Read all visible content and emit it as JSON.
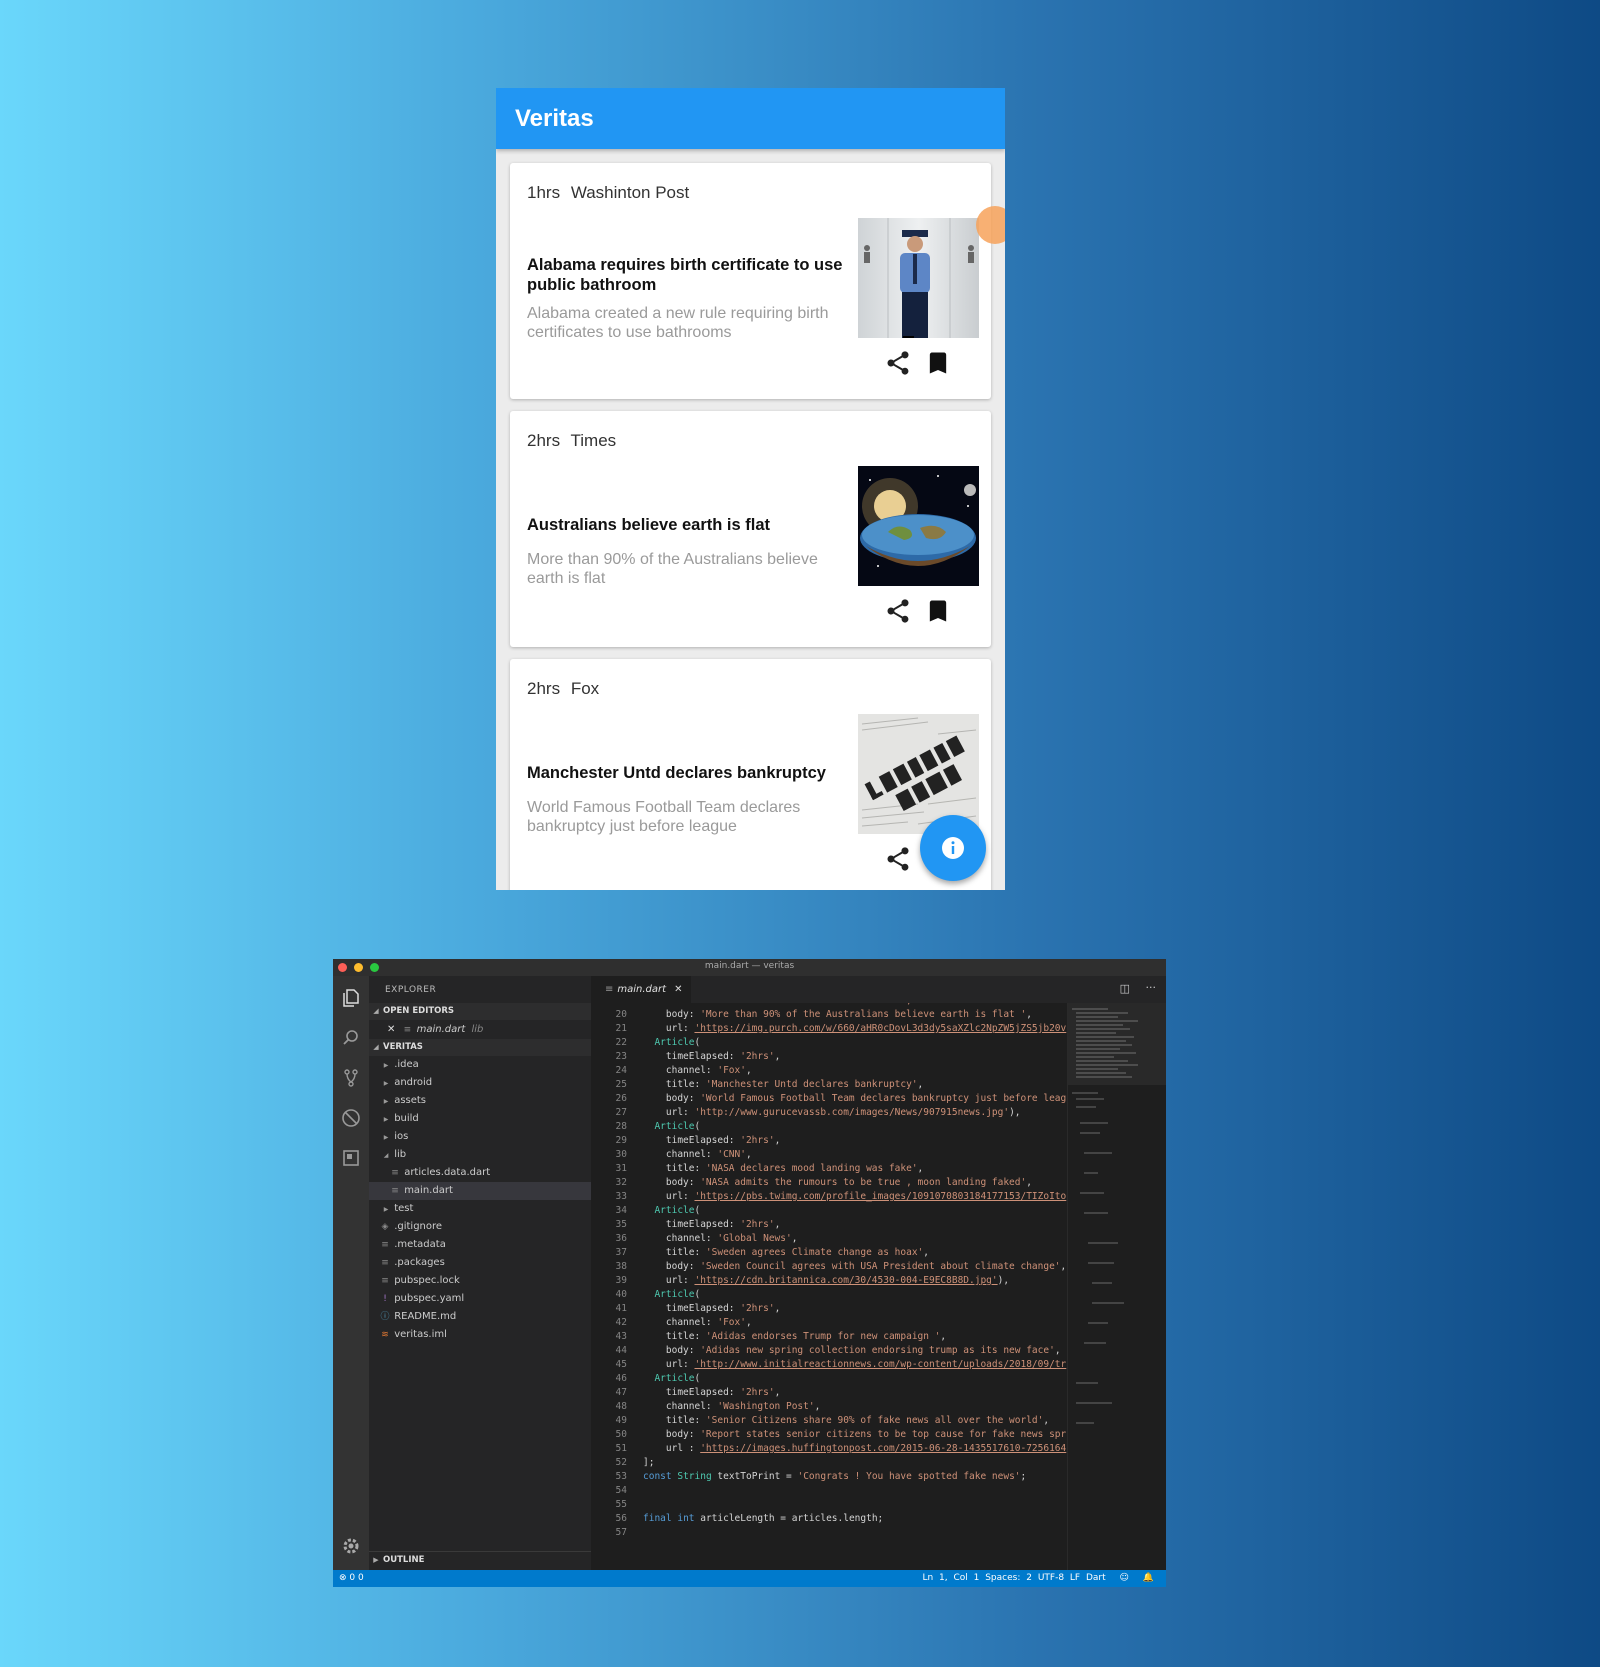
{
  "app": {
    "title": "Veritas",
    "cards": [
      {
        "time": "1hrs",
        "channel": "Washinton Post",
        "title": "Alabama requires birth certificate to use public bathroom",
        "body": "Alabama created a new rule requiring birth certificates to use bathrooms",
        "image": "police-officer-bathroom-photo"
      },
      {
        "time": "2hrs",
        "channel": "Times",
        "title": "Australians believe earth is flat",
        "body": "More than 90% of the Australians believe earth is flat",
        "image": "flat-earth-photo"
      },
      {
        "time": "2hrs",
        "channel": "Fox",
        "title": "Manchester Untd declares bankruptcy",
        "body": "World Famous Football Team declares bankruptcy just before league",
        "image": "latest-news-newspaper-photo"
      }
    ],
    "icons": {
      "share": "share-icon",
      "bookmark": "bookmark-icon",
      "info": "info-icon"
    },
    "accent_color": "#2196f3"
  },
  "vscode": {
    "window_title": "main.dart — veritas",
    "explorer_label": "EXPLORER",
    "open_editors_label": "OPEN EDITORS",
    "open_editor_file": "main.dart",
    "open_editor_path": "lib",
    "project_label": "VERITAS",
    "files": [
      ".idea",
      "android",
      "assets",
      "build",
      "ios",
      "lib",
      "articles.data.dart",
      "main.dart",
      "test",
      ".gitignore",
      ".metadata",
      ".packages",
      "pubspec.lock",
      "pubspec.yaml",
      "README.md",
      "veritas.iml"
    ],
    "outline_label": "OUTLINE",
    "tab_label": "main.dart",
    "line_numbers": [
      "20",
      "21",
      "22",
      "23",
      "24",
      "25",
      "26",
      "27",
      "28",
      "29",
      "30",
      "31",
      "32",
      "33",
      "34",
      "35",
      "36",
      "37",
      "38",
      "39",
      "40",
      "41",
      "42",
      "43",
      "44",
      "45",
      "46",
      "47",
      "48",
      "49",
      "50",
      "51",
      "52",
      "53",
      "54",
      "55",
      "56",
      "57"
    ],
    "status_left": "0  0",
    "status_right": "Ln 1, Col 1   Spaces: 2   UTF-8   LF   Dart"
  }
}
